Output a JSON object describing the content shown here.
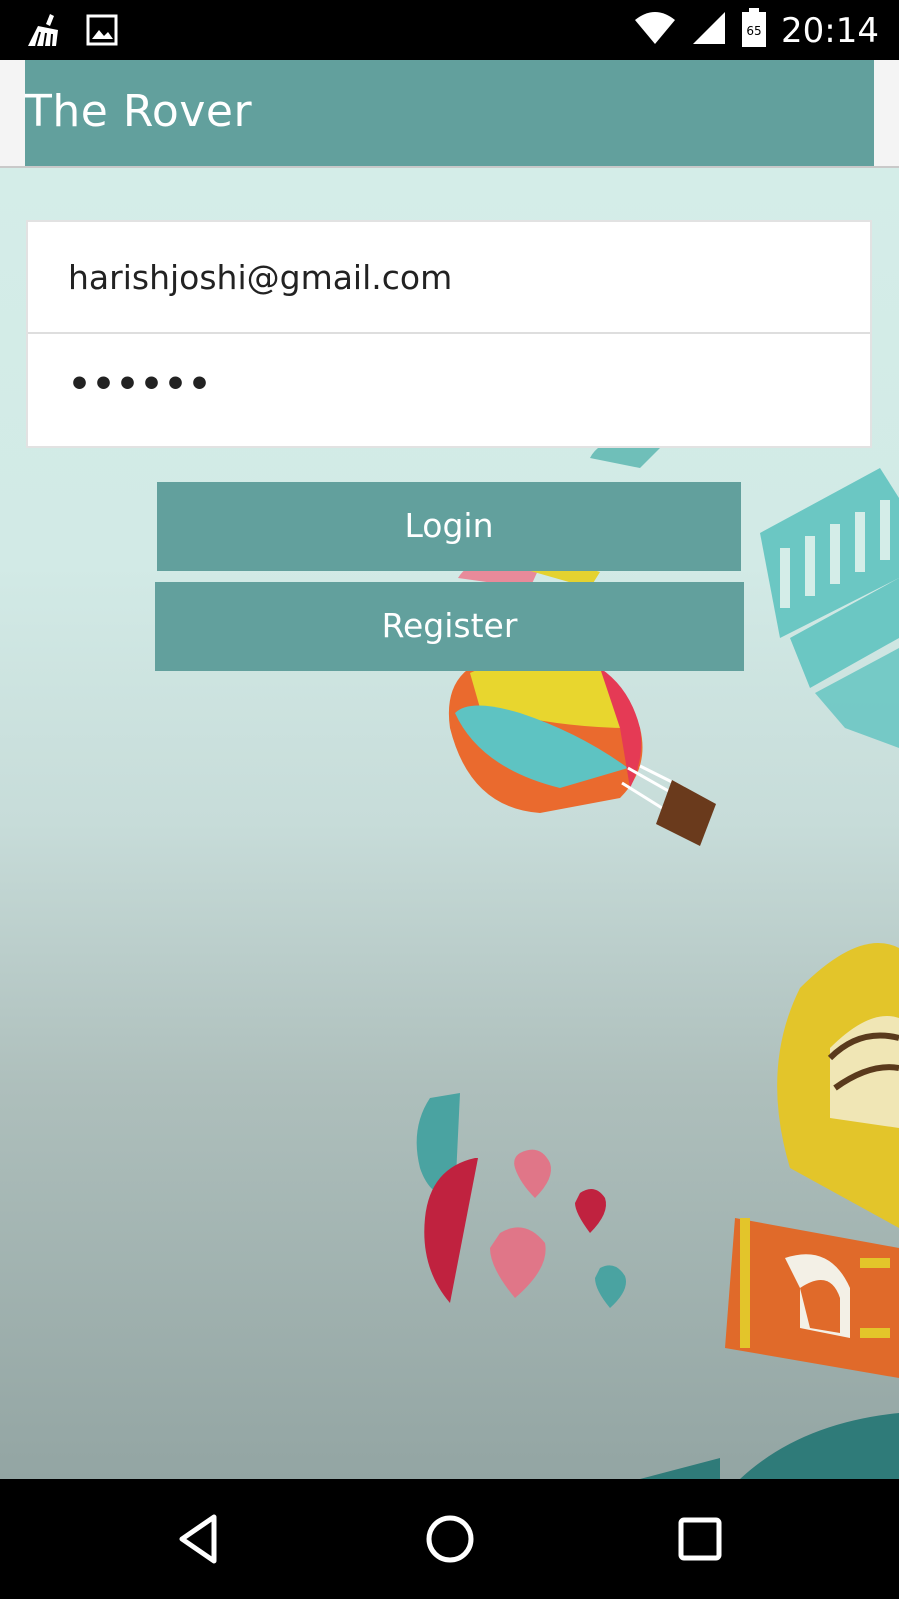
{
  "status_bar": {
    "time": "20:14",
    "battery_level": "65",
    "left_icons": [
      "cleaner-icon",
      "image-icon"
    ],
    "right_icons": [
      "wifi-icon",
      "cell-signal-icon",
      "battery-icon"
    ]
  },
  "app_bar": {
    "title": "The Rover",
    "color": "#62a09d"
  },
  "login_form": {
    "email_value": "harishjoshi@gmail.com",
    "password_value": "••••••"
  },
  "buttons": {
    "login_label": "Login",
    "register_label": "Register"
  },
  "nav_bar": {
    "buttons": [
      "back-icon",
      "home-icon",
      "recents-icon"
    ]
  },
  "colors": {
    "accent": "#62a09d",
    "background_top": "#d4ede8",
    "background_bottom": "#93a5a3"
  }
}
